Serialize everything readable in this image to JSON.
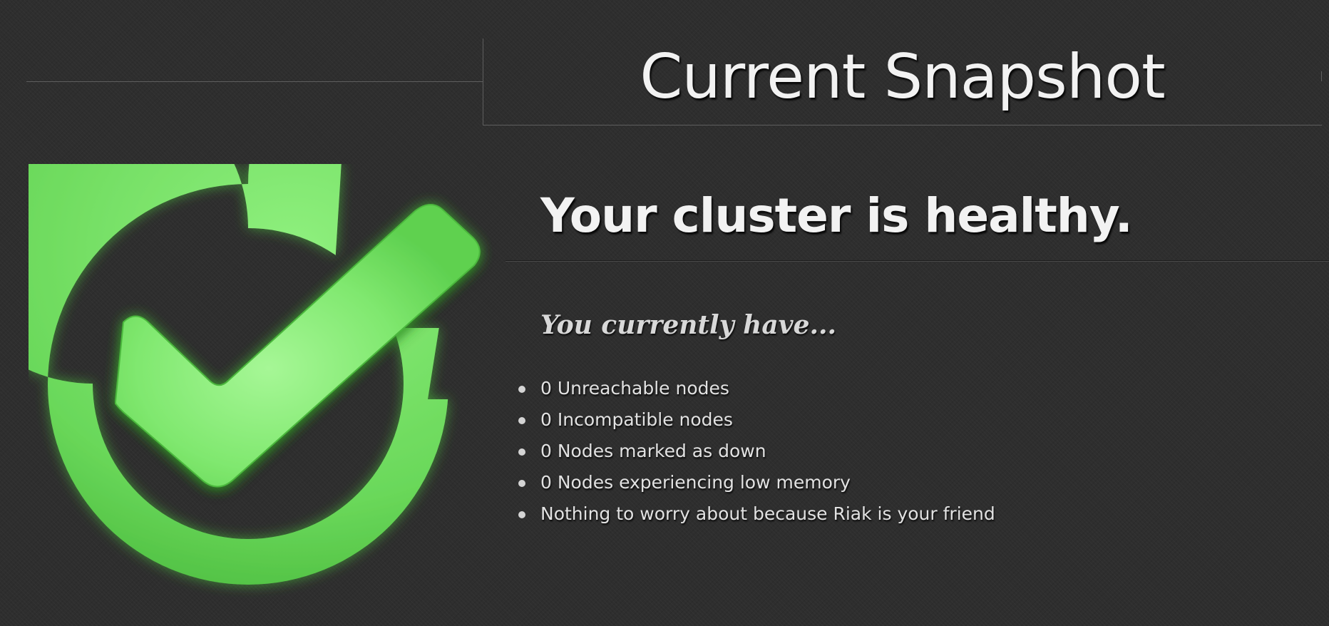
{
  "header": {
    "title": "Current Snapshot"
  },
  "status": {
    "icon": "checkmark-circle-icon",
    "heading": "Your cluster is healthy.",
    "color": "#6fd65f"
  },
  "summary": {
    "intro": "You currently have...",
    "items": [
      "0 Unreachable nodes",
      "0 Incompatible nodes",
      "0 Nodes marked as down",
      "0 Nodes experiencing low memory",
      "Nothing to worry about because Riak is your friend"
    ]
  }
}
